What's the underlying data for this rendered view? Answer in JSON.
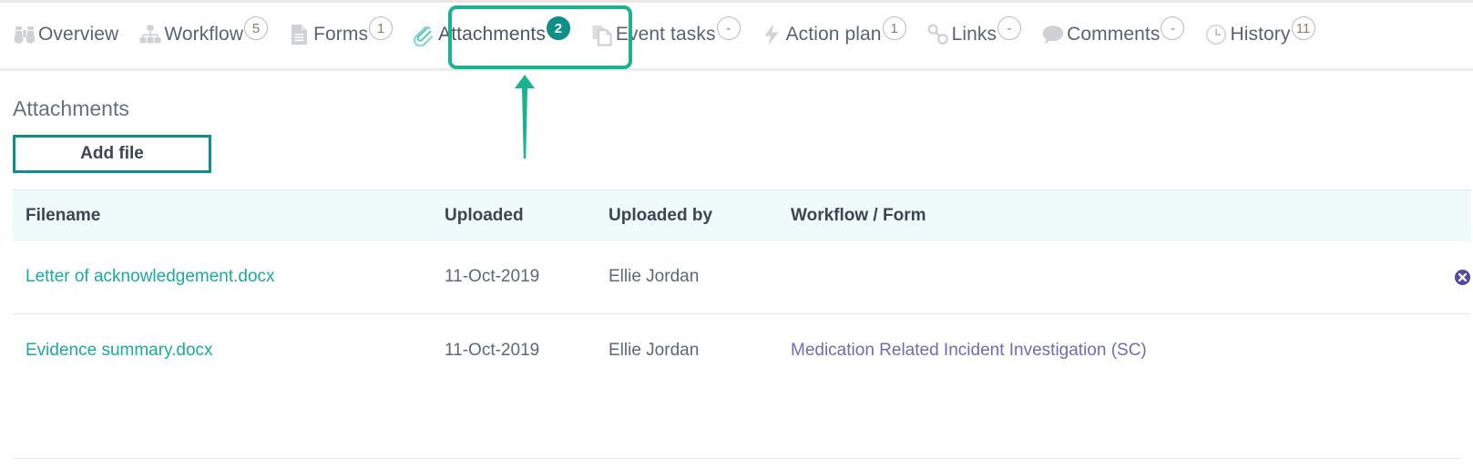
{
  "theme": {
    "accent_teal": "#0e8f87",
    "highlight_green": "#19b38f",
    "link_teal": "#1aaa9e",
    "link_purple": "#6f6bb5",
    "header_bg": "#effafa",
    "delete_purple": "#514aa5"
  },
  "tabs": [
    {
      "label": "Overview",
      "badge": "",
      "icon": "binoculars-icon",
      "active": false
    },
    {
      "label": "Workflow",
      "badge": "5",
      "icon": "sitemap-icon",
      "active": false
    },
    {
      "label": "Forms",
      "badge": "1",
      "icon": "document-icon",
      "active": false
    },
    {
      "label": "Attachments",
      "badge": "2",
      "icon": "paperclip-icon",
      "active": true
    },
    {
      "label": "Event tasks",
      "badge": "-",
      "icon": "copy-pages-icon",
      "active": false
    },
    {
      "label": "Action plan",
      "badge": "1",
      "icon": "lightning-icon",
      "active": false
    },
    {
      "label": "Links",
      "badge": "-",
      "icon": "chain-link-icon",
      "active": false
    },
    {
      "label": "Comments",
      "badge": "-",
      "icon": "speech-bubble-icon",
      "active": false
    },
    {
      "label": "History",
      "badge": "11",
      "icon": "clock-icon",
      "active": false
    }
  ],
  "page": {
    "title": "Attachments",
    "add_file_label": "Add file"
  },
  "table": {
    "columns": [
      "Filename",
      "Uploaded",
      "Uploaded by",
      "Workflow / Form",
      ""
    ],
    "rows": [
      {
        "filename": "Letter of acknowledgement.docx",
        "uploaded": "11-Oct-2019",
        "uploaded_by": "Ellie Jordan",
        "workflow_form": "",
        "delete_icon": "delete-circle-icon"
      },
      {
        "filename": "Evidence summary.docx",
        "uploaded": "11-Oct-2019",
        "uploaded_by": "Ellie Jordan",
        "workflow_form": "Medication Related Incident Investigation (SC)",
        "delete_icon": ""
      }
    ]
  },
  "annotation": {
    "type": "up-arrow",
    "points_to": "Attachments",
    "color": "#19b38f"
  }
}
